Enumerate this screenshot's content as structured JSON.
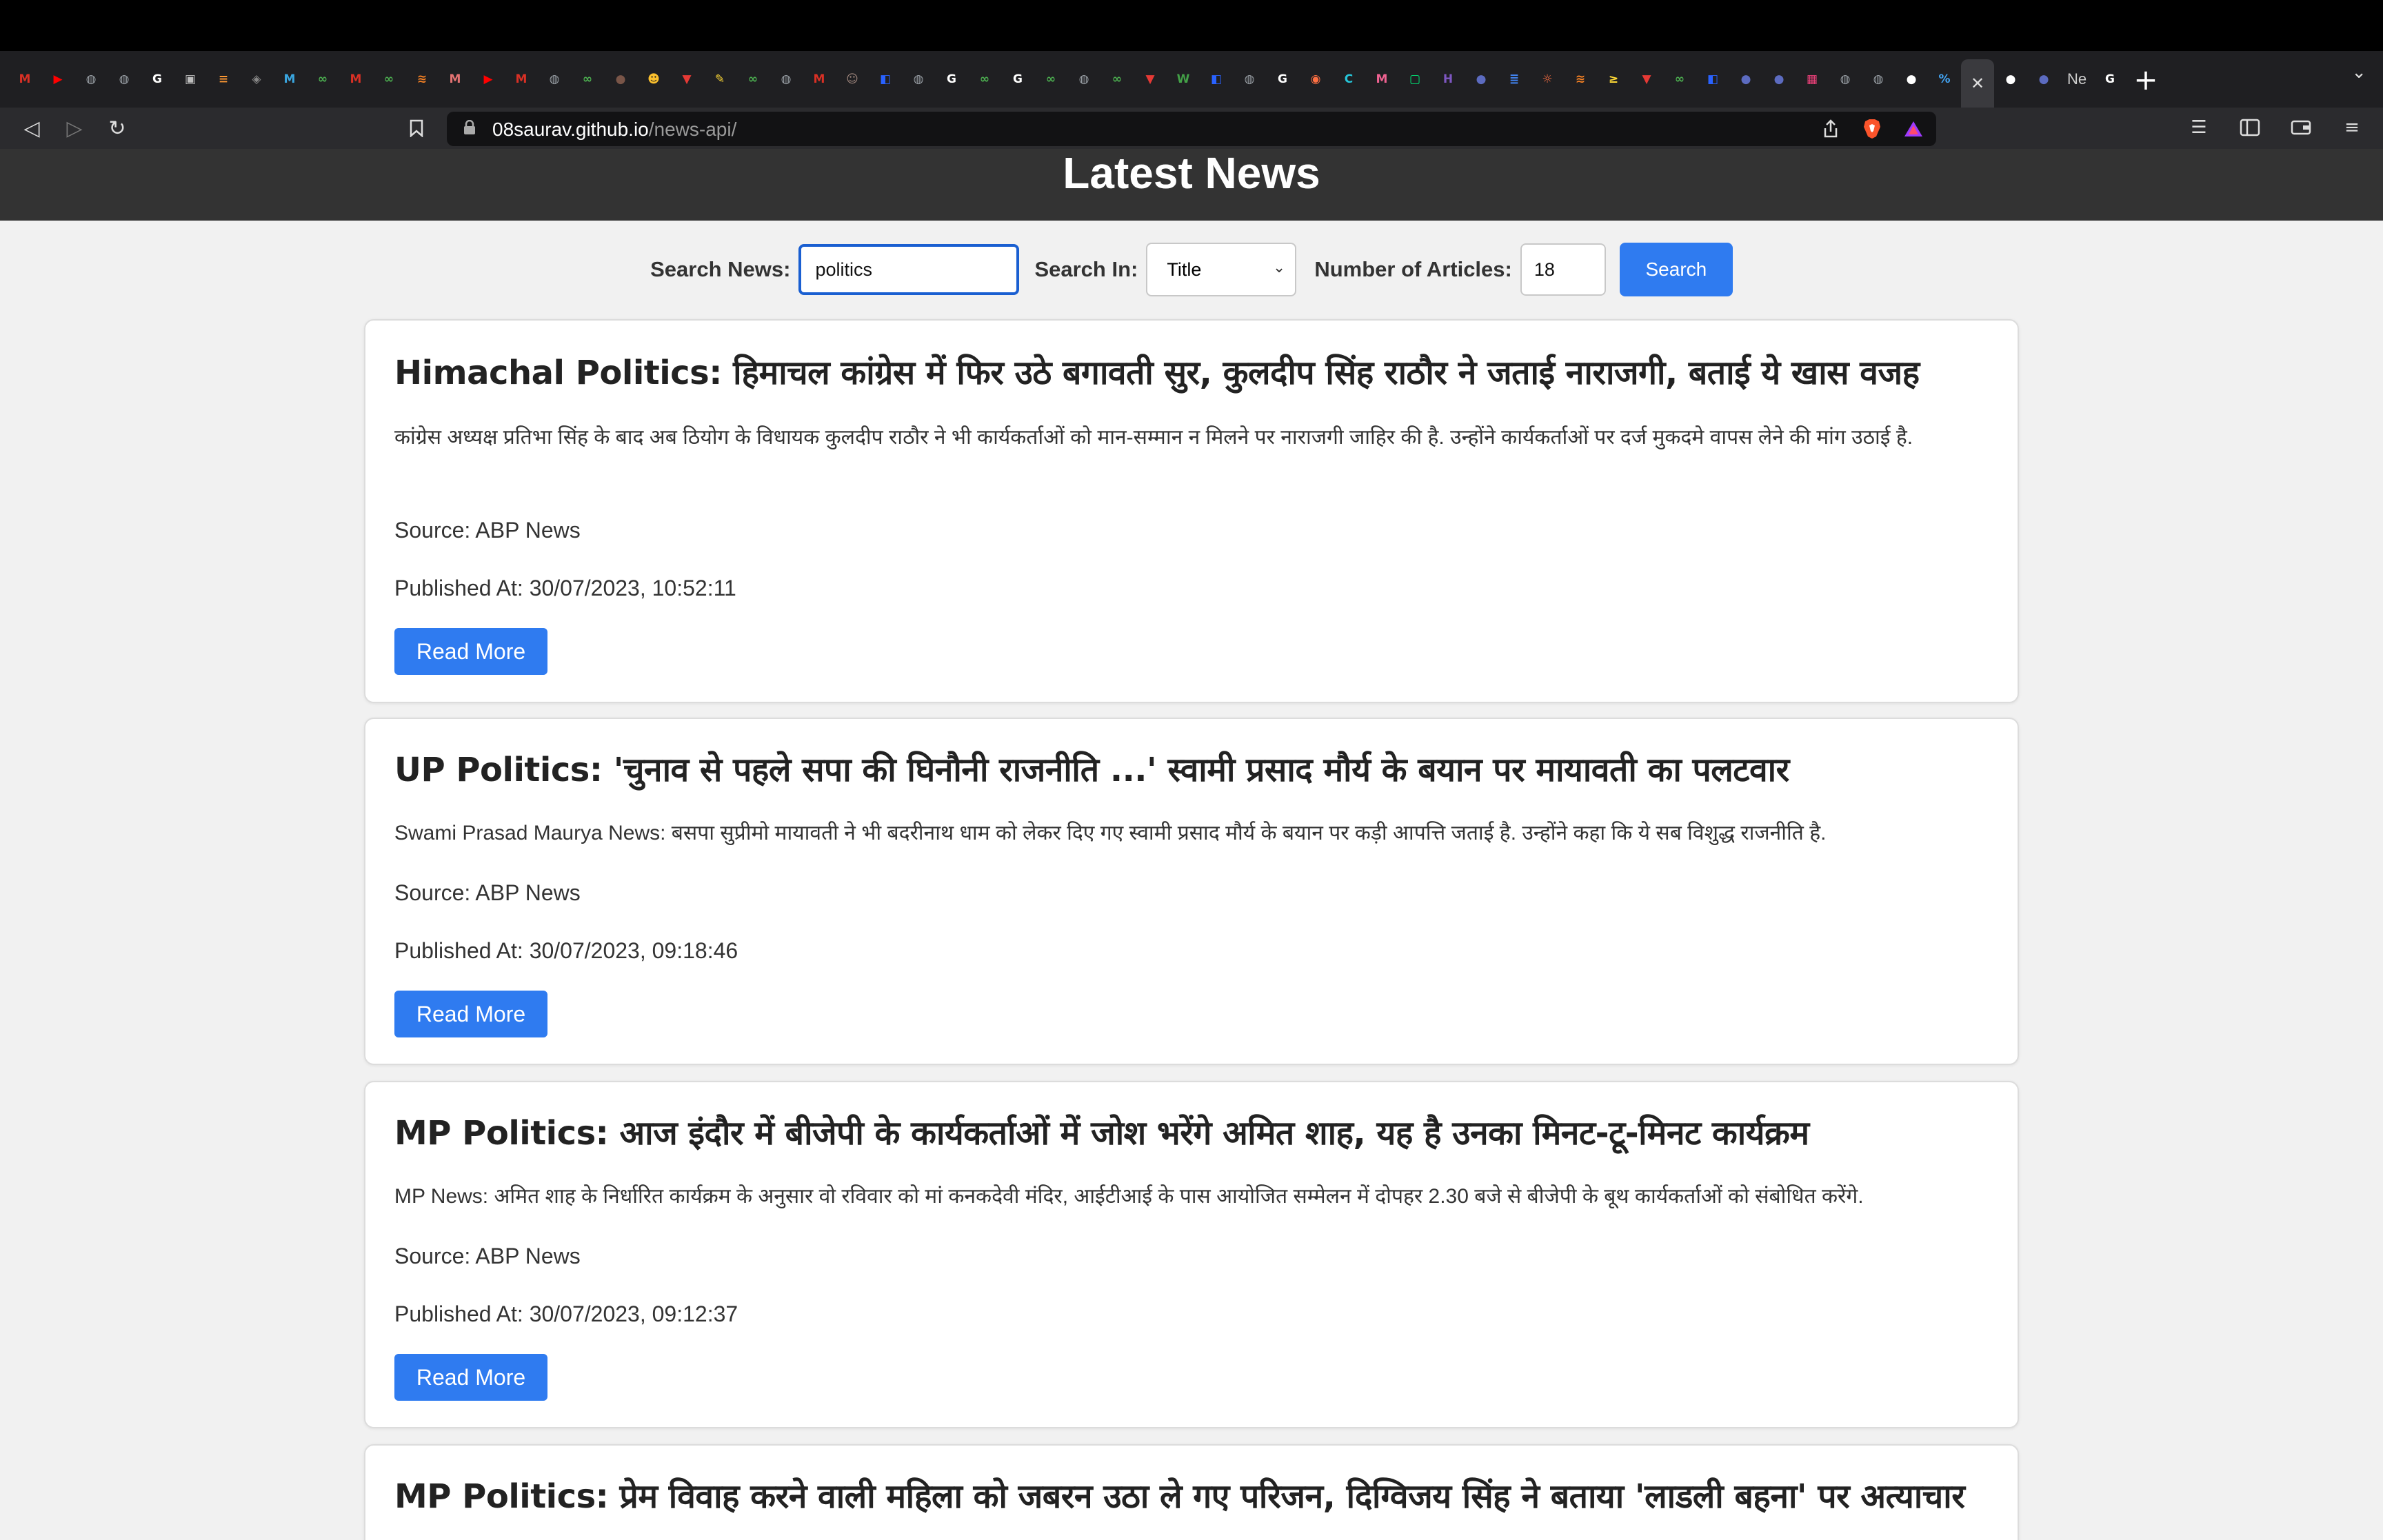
{
  "browser": {
    "url_host": "08saurav.github.io",
    "url_path": "/news-api/",
    "new_tab_partial_title": "Ne",
    "tabs": [
      {
        "icon": "gmail-icon",
        "color": "#d93025",
        "glyph": "M"
      },
      {
        "icon": "youtube-icon",
        "color": "#ff0000",
        "glyph": "▶"
      },
      {
        "icon": "globe-icon",
        "color": "#9aa0a6",
        "glyph": "◍"
      },
      {
        "icon": "globe-icon",
        "color": "#9aa0a6",
        "glyph": "◍"
      },
      {
        "icon": "google-icon",
        "color": "#ffffff",
        "glyph": "G"
      },
      {
        "icon": "camera-icon",
        "color": "#bdbdbd",
        "glyph": "▣"
      },
      {
        "icon": "flag-icon",
        "color": "#ff9933",
        "glyph": "≡"
      },
      {
        "icon": "robot-icon",
        "color": "#888",
        "glyph": "◈"
      },
      {
        "icon": "gmail-icon",
        "color": "#3aa6e0",
        "glyph": "M"
      },
      {
        "icon": "link-icon",
        "color": "#4caf50",
        "glyph": "∞"
      },
      {
        "icon": "gmail-icon",
        "color": "#d93025",
        "glyph": "M"
      },
      {
        "icon": "link-icon",
        "color": "#4caf50",
        "glyph": "∞"
      },
      {
        "icon": "stack-icon",
        "color": "#f48024",
        "glyph": "≋"
      },
      {
        "icon": "gmail-icon",
        "color": "#e57373",
        "glyph": "M"
      },
      {
        "icon": "youtube-icon",
        "color": "#ff0000",
        "glyph": "▶"
      },
      {
        "icon": "gmail-icon",
        "color": "#d93025",
        "glyph": "M"
      },
      {
        "icon": "globe-icon",
        "color": "#9aa0a6",
        "glyph": "◍"
      },
      {
        "icon": "link-icon",
        "color": "#4caf50",
        "glyph": "∞"
      },
      {
        "icon": "avatar-icon",
        "color": "#795548",
        "glyph": "●"
      },
      {
        "icon": "emoji-icon",
        "color": "#fbc02d",
        "glyph": "☻"
      },
      {
        "icon": "vercel-icon",
        "color": "#e53935",
        "glyph": "▼"
      },
      {
        "icon": "pencil-icon",
        "color": "#fdd835",
        "glyph": "✎"
      },
      {
        "icon": "link-icon",
        "color": "#4caf50",
        "glyph": "∞"
      },
      {
        "icon": "globe-icon",
        "color": "#9aa0a6",
        "glyph": "◍"
      },
      {
        "icon": "gmail-icon",
        "color": "#d93025",
        "glyph": "M"
      },
      {
        "icon": "person-icon",
        "color": "#a1887f",
        "glyph": "☺"
      },
      {
        "icon": "cube-icon",
        "color": "#2962ff",
        "glyph": "◧"
      },
      {
        "icon": "globe-icon",
        "color": "#9aa0a6",
        "glyph": "◍"
      },
      {
        "icon": "google-icon",
        "color": "#ffffff",
        "glyph": "G"
      },
      {
        "icon": "link-icon",
        "color": "#4caf50",
        "glyph": "∞"
      },
      {
        "icon": "google-icon",
        "color": "#ffffff",
        "glyph": "G"
      },
      {
        "icon": "link-icon",
        "color": "#4caf50",
        "glyph": "∞"
      },
      {
        "icon": "globe-icon",
        "color": "#9aa0a6",
        "glyph": "◍"
      },
      {
        "icon": "link-icon",
        "color": "#4caf50",
        "glyph": "∞"
      },
      {
        "icon": "vercel-icon",
        "color": "#e53935",
        "glyph": "▼"
      },
      {
        "icon": "w-icon",
        "color": "#43a047",
        "glyph": "W"
      },
      {
        "icon": "cube-icon",
        "color": "#2962ff",
        "glyph": "◧"
      },
      {
        "icon": "globe-icon",
        "color": "#9aa0a6",
        "glyph": "◍"
      },
      {
        "icon": "google-icon",
        "color": "#ffffff",
        "glyph": "G"
      },
      {
        "icon": "chat-icon",
        "color": "#ff7043",
        "glyph": "◉"
      },
      {
        "icon": "c-icon",
        "color": "#26c6da",
        "glyph": "C"
      },
      {
        "icon": "gmail-icon",
        "color": "#f06292",
        "glyph": "M"
      },
      {
        "icon": "frame-icon",
        "color": "#00e676",
        "glyph": "▢"
      },
      {
        "icon": "h-icon",
        "color": "#7e57c2",
        "glyph": "H"
      },
      {
        "icon": "circle-icon",
        "color": "#5c6bc0",
        "glyph": "●"
      },
      {
        "icon": "docs-icon",
        "color": "#4285f4",
        "glyph": "≣"
      },
      {
        "icon": "sun-icon",
        "color": "#ff7043",
        "glyph": "☼"
      },
      {
        "icon": "stack-icon",
        "color": "#f48024",
        "glyph": "≋"
      },
      {
        "icon": "arrow-icon",
        "color": "#fdd835",
        "glyph": "≥"
      },
      {
        "icon": "vercel-icon",
        "color": "#e53935",
        "glyph": "▼"
      },
      {
        "icon": "link-icon",
        "color": "#4caf50",
        "glyph": "∞"
      },
      {
        "icon": "cube-icon",
        "color": "#2962ff",
        "glyph": "◧"
      },
      {
        "icon": "circle-icon",
        "color": "#5c6bc0",
        "glyph": "●"
      },
      {
        "icon": "circle-icon",
        "color": "#5c6bc0",
        "glyph": "●"
      },
      {
        "icon": "calendar-icon",
        "color": "#ec407a",
        "glyph": "▦"
      },
      {
        "icon": "globe-icon",
        "color": "#9aa0a6",
        "glyph": "◍"
      },
      {
        "icon": "globe-icon",
        "color": "#9aa0a6",
        "glyph": "◍"
      },
      {
        "icon": "github-icon",
        "color": "#ffffff",
        "glyph": "●"
      },
      {
        "icon": "link2-icon",
        "color": "#42a5f5",
        "glyph": "%"
      },
      {
        "icon": "close-icon",
        "color": "#dddddd",
        "glyph": "✕",
        "active": true
      },
      {
        "icon": "github-icon",
        "color": "#ffffff",
        "glyph": "●"
      },
      {
        "icon": "circle-icon",
        "color": "#5c6bc0",
        "glyph": "●"
      }
    ]
  },
  "page": {
    "title": "Latest News",
    "search": {
      "label": "Search News:",
      "value": "politics",
      "in_label": "Search In:",
      "in_value": "Title",
      "count_label": "Number of Articles:",
      "count_value": "18",
      "button": "Search"
    },
    "articles": [
      {
        "title": "Himachal Politics: हिमाचल कांग्रेस में फिर उठे बगावती सुर, कुलदीप सिंह राठौर ने जताई नाराजगी, बताई ये खास वजह",
        "description": "कांग्रेस अध्यक्ष प्रतिभा सिंह के बाद अब ठियोग के विधायक कुलदीप राठौर ने भी कार्यकर्ताओं को मान-सम्मान न मिलने पर नाराजगी जाहिर की है. उन्होंने कार्यकर्ताओं पर दर्ज मुकदमे वापस लेने की मांग उठाई है.",
        "source": "Source: ABP News",
        "published": "Published At: 30/07/2023, 10:52:11",
        "read_more": "Read More"
      },
      {
        "title": "UP Politics: 'चुनाव से पहले सपा की घिनौनी राजनीति ...' स्वामी प्रसाद मौर्य के बयान पर मायावती का पलटवार",
        "description": "Swami Prasad Maurya News: बसपा सुप्रीमो मायावती ने भी बदरीनाथ धाम को लेकर दिए गए स्वामी प्रसाद मौर्य के बयान पर कड़ी आपत्ति जताई है. उन्होंने कहा कि ये सब विशुद्ध राजनीति है.",
        "source": "Source: ABP News",
        "published": "Published At: 30/07/2023, 09:18:46",
        "read_more": "Read More"
      },
      {
        "title": "MP Politics: आज इंदौर में बीजेपी के कार्यकर्ताओं में जोश भरेंगे अमित शाह, यह है उनका मिनट-टू-मिनट कार्यक्रम",
        "description": "MP News: अमित शाह के निर्धारित कार्यक्रम के अनुसार वो रविवार को मां कनकदेवी मंदिर, आईटीआई के पास आयोजित सम्मेलन में दोपहर 2.30 बजे से बीजेपी के बूथ कार्यकर्ताओं को संबोधित करेंगे.",
        "source": "Source: ABP News",
        "published": "Published At: 30/07/2023, 09:12:37",
        "read_more": "Read More"
      },
      {
        "title": "MP Politics: प्रेम विवाह करने वाली महिला को जबरन उठा ले गए परिजन, दिग्विजय सिंह ने बताया 'लाडली बहना' पर अत्याचार"
      }
    ]
  }
}
